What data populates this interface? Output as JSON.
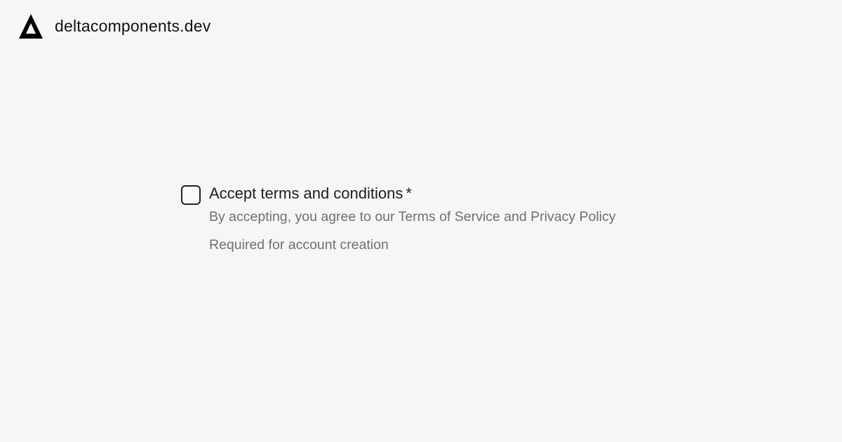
{
  "brand": {
    "name": "deltacomponents.dev",
    "logo_icon": "delta-triangle-logo"
  },
  "form": {
    "checkbox": {
      "checked": false,
      "label": "Accept terms and conditions",
      "required_marker": "*",
      "description": "By accepting, you agree to our Terms of Service and Privacy Policy",
      "helper": "Required for account creation"
    }
  },
  "colors": {
    "background": "#f6f6f6",
    "text": "#1d1d1d",
    "muted_text": "#6f6f72",
    "checkbox_border": "#222222"
  }
}
